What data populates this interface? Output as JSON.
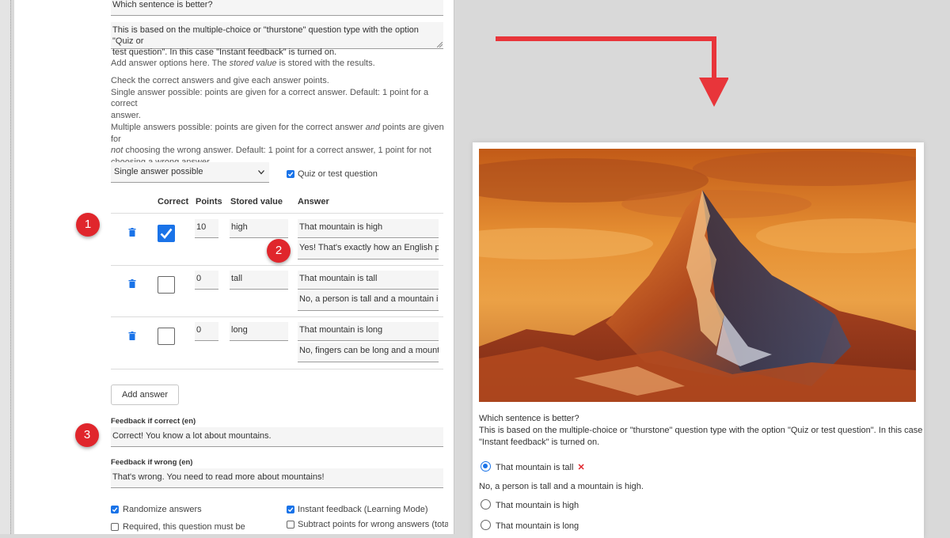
{
  "editor": {
    "question_title": "Which sentence is better?",
    "description_line1": "This is based on the multiple-choice or \"thurstone\" question type with the option \"Quiz or",
    "description_line2": "test question\". In this case \"Instant feedback\" is turned on.",
    "help_add_prefix": "Add answer options here. The ",
    "help_add_em": "stored value",
    "help_add_suffix": " is stored with the results.",
    "help_check": "Check the correct answers and give each answer points.",
    "help_single_1": "Single answer possible: points are given for a correct answer. Default: 1 point for a correct",
    "help_single_2": "answer.",
    "help_multi_1a": "Multiple answers possible: points are given for the correct answer ",
    "help_multi_1_em": "and",
    "help_multi_1b": " points are given for",
    "help_multi_2_em": "not",
    "help_multi_2b": " choosing the wrong answer. Default: 1 point for a correct answer, 1 point for not",
    "help_multi_3": "choosing a wrong answer.",
    "answer_mode_select": "Single answer possible",
    "quiz_checkbox_label": "Quiz or test question",
    "columns": {
      "correct": "Correct",
      "points": "Points",
      "stored_value": "Stored value",
      "answer": "Answer"
    },
    "rows": [
      {
        "correct": true,
        "points": "10",
        "stored": "high",
        "answer": "That mountain is high",
        "feedback": "Yes! That's exactly how an English per"
      },
      {
        "correct": false,
        "points": "0",
        "stored": "tall",
        "answer": "That mountain is tall",
        "feedback": "No, a person is tall and a mountain is h"
      },
      {
        "correct": false,
        "points": "0",
        "stored": "long",
        "answer": "That mountain is long",
        "feedback": "No, fingers can be long and a mountai"
      }
    ],
    "add_answer_button": "Add answer",
    "feedback_correct_label": "Feedback if correct (en)",
    "feedback_correct_value": "Correct! You know a lot about mountains.",
    "feedback_wrong_label": "Feedback if wrong (en)",
    "feedback_wrong_value": "That's wrong. You need to read more about mountains!",
    "options": {
      "randomize": "Randomize answers",
      "required": "Required, this question must be",
      "instant_feedback": "Instant feedback (Learning Mode)",
      "subtract_points": "Subtract points for wrong answers (total"
    }
  },
  "badges": [
    "1",
    "2",
    "3"
  ],
  "preview": {
    "question": "Which sentence is better?",
    "description_line1": "This is based on the multiple-choice or \"thurstone\" question type with the option \"Quiz or test question\". In this case",
    "description_line2": "\"Instant feedback\" is turned on.",
    "options": [
      {
        "label": "That mountain is tall",
        "selected": true,
        "wrong_mark": "✕"
      },
      {
        "label": "That mountain is high",
        "selected": false
      },
      {
        "label": "That mountain is long",
        "selected": false
      }
    ],
    "feedback_text": "No, a person is tall and a mountain is high."
  },
  "colors": {
    "accent_blue": "#1a73e8",
    "badge_red": "#e0262c",
    "arrow_red": "#e8353a"
  }
}
